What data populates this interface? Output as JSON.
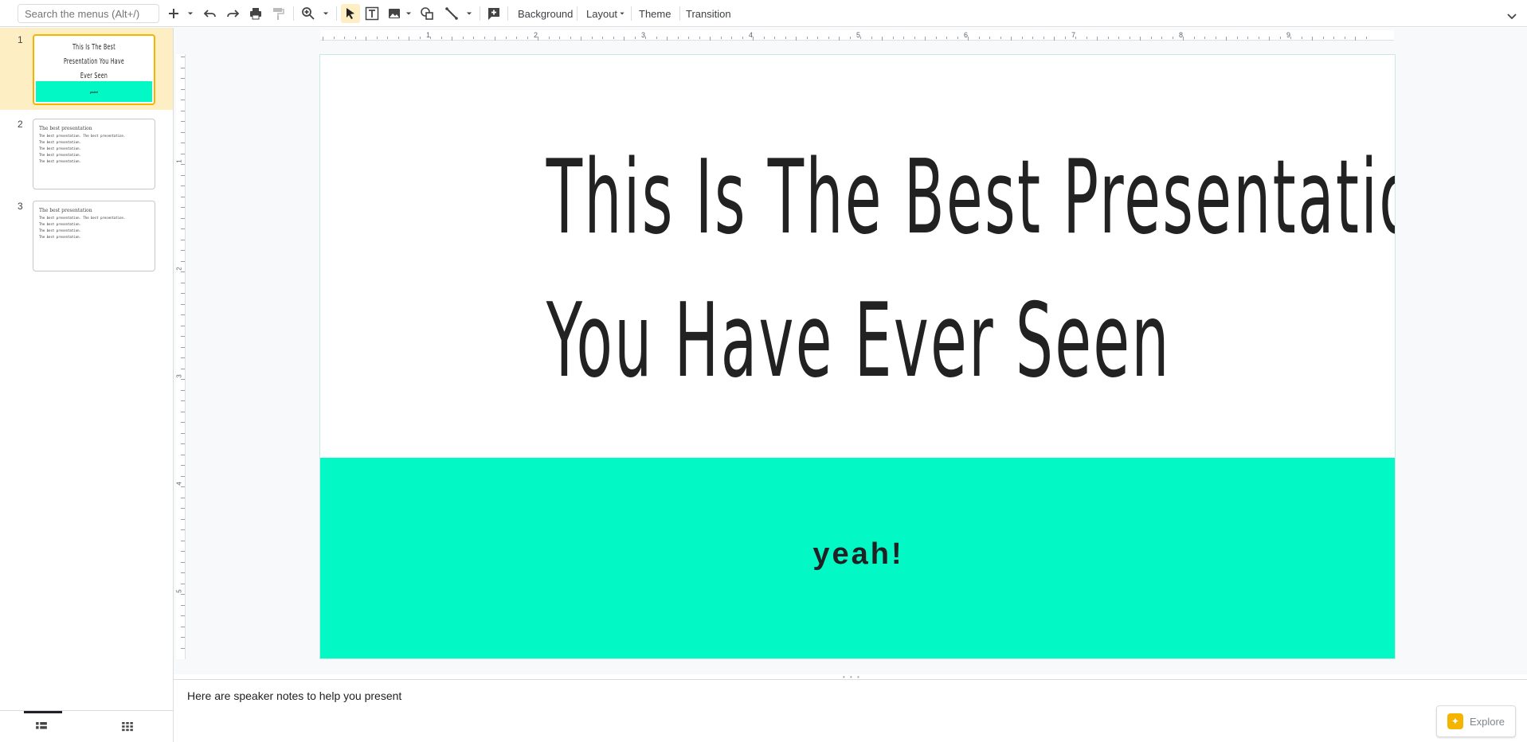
{
  "toolbar": {
    "search_placeholder": "Search the menus (Alt+/)",
    "background_label": "Background",
    "layout_label": "Layout",
    "theme_label": "Theme",
    "transition_label": "Transition"
  },
  "filmstrip": {
    "slides": [
      {
        "number": "1",
        "title": "This Is The Best Presentation You Have Ever Seen",
        "subtitle": "yeah!"
      },
      {
        "number": "2",
        "title": "The best presentation",
        "lines": [
          "The best presentation. The best presentation.",
          "The best presentation.",
          "The best presentation.",
          "The best presentation.",
          "The best presentation."
        ]
      },
      {
        "number": "3",
        "title": "The best presentation",
        "lines": [
          "The best presentation. The best presentation.",
          "The best presentation.",
          "The best presentation.",
          "The best presentation."
        ]
      }
    ]
  },
  "ruler": {
    "h_numbers": [
      "1",
      "2",
      "3",
      "4",
      "5",
      "6",
      "7",
      "8",
      "9"
    ],
    "v_numbers": [
      "1",
      "2",
      "3",
      "4",
      "5"
    ]
  },
  "slide": {
    "title_line1": "This Is The Best Presentation",
    "title_line2": "You Have Ever Seen",
    "subtitle": "yeah!",
    "band_color": "#02f9c5"
  },
  "notes": {
    "text": "Here are speaker notes to help you present"
  },
  "explore": {
    "label": "Explore"
  }
}
